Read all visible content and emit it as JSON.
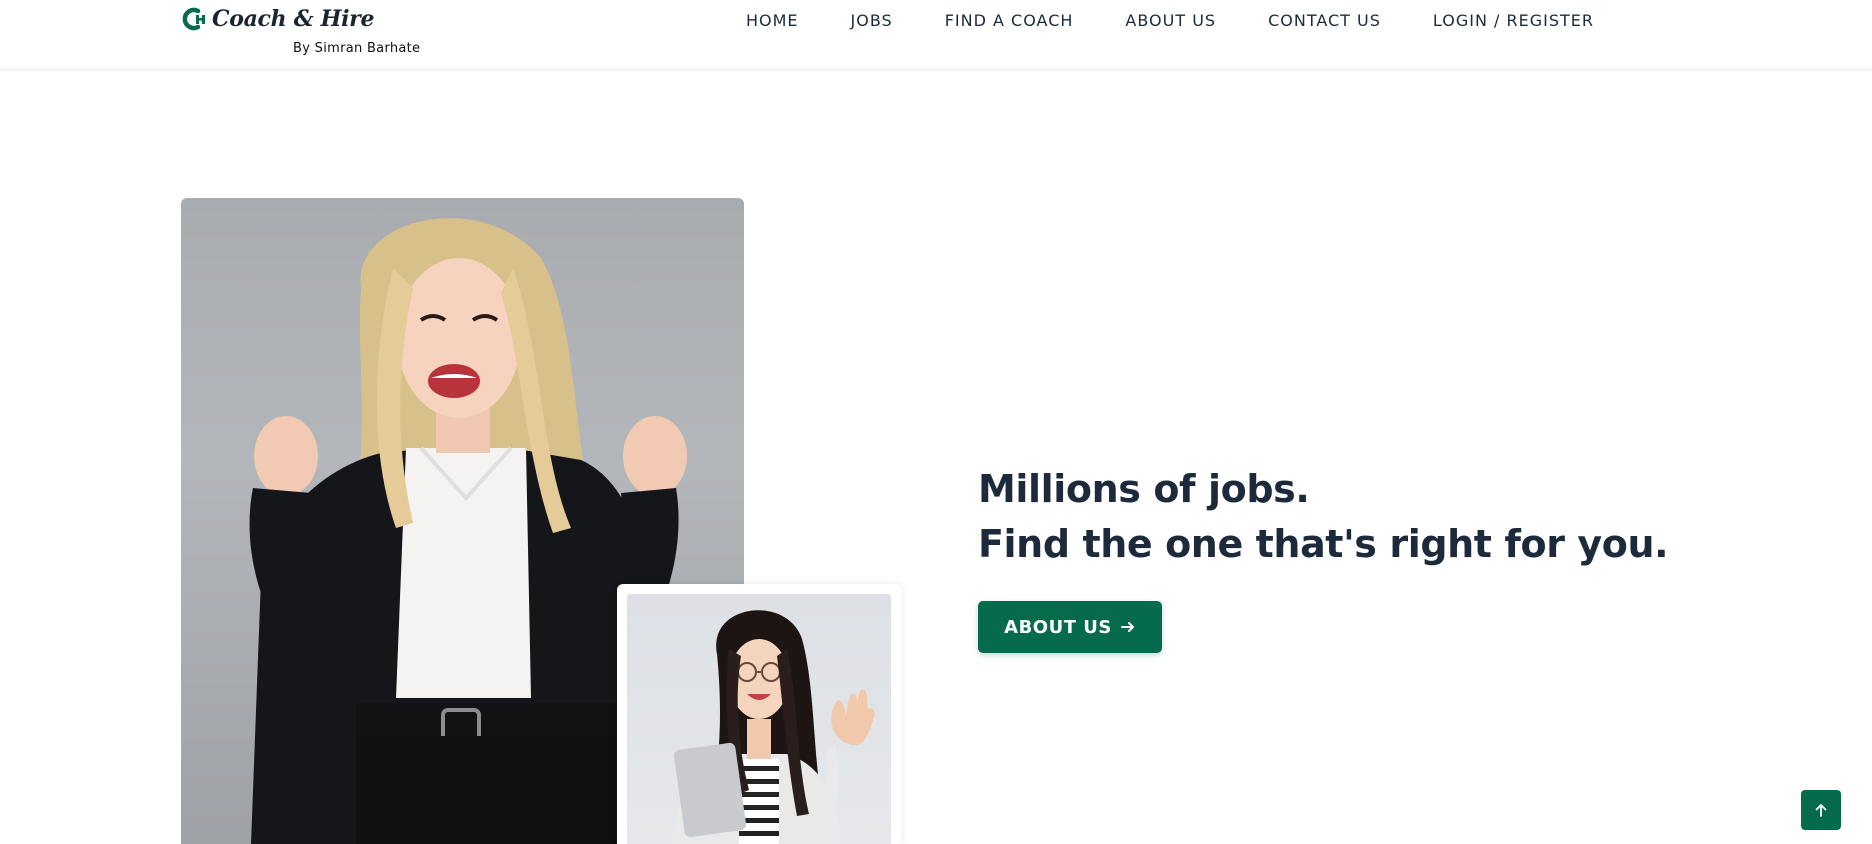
{
  "brand": {
    "name": "Coach & Hire",
    "tagline": "By Simran Barhate",
    "logo_icon": "ch-monogram-icon",
    "color": "#066a4d"
  },
  "nav": {
    "items": [
      {
        "label": "HOME"
      },
      {
        "label": "JOBS"
      },
      {
        "label": "FIND A COACH"
      },
      {
        "label": "ABOUT US"
      },
      {
        "label": "CONTACT US"
      },
      {
        "label": "LOGIN / REGISTER"
      }
    ]
  },
  "hero": {
    "headline_line1": "Millions of jobs.",
    "headline_line2": "Find the one that's right for you.",
    "button_label": "ABOUT US",
    "button_icon": "arrow-right-icon",
    "main_image": "celebrating-woman-photo",
    "secondary_image": "waving-woman-laptop-photo"
  },
  "scroll_top": {
    "icon": "arrow-up-icon"
  },
  "colors": {
    "accent": "#066a4d",
    "text": "#1c2a3c",
    "background": "#ffffff"
  }
}
